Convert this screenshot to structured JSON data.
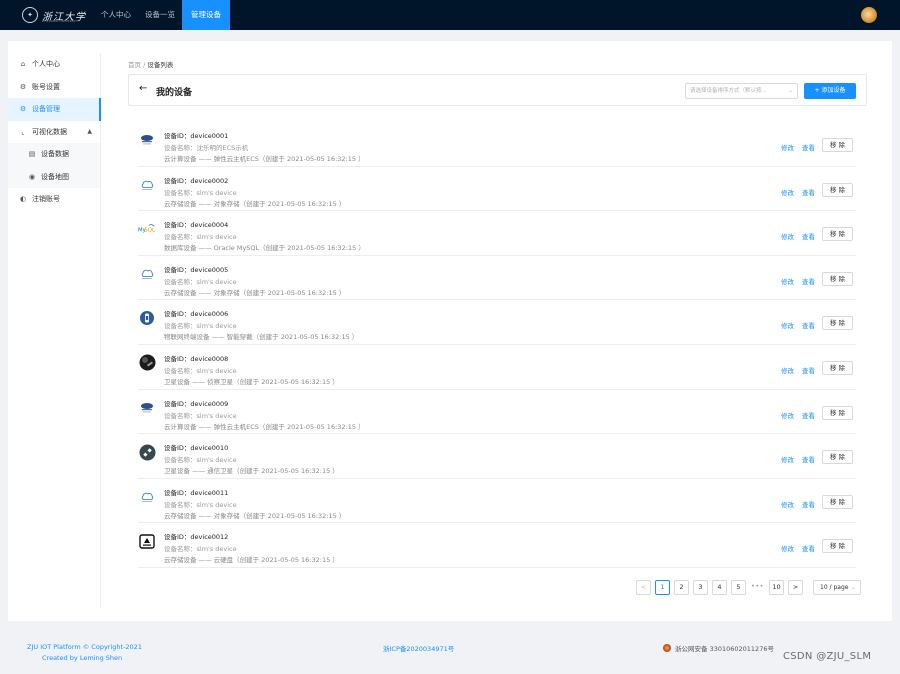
{
  "topnav": {
    "logo_text": "浙江大学",
    "logo_sub": "ZHEJIANG UNIVERSITY",
    "items": [
      {
        "label": "个人中心"
      },
      {
        "label": "设备一览"
      },
      {
        "label": "管理设备",
        "active": true
      }
    ]
  },
  "sidebar": {
    "items": [
      {
        "label": "个人中心",
        "icon": "home-icon"
      },
      {
        "label": "账号设置",
        "icon": "gear-icon"
      },
      {
        "label": "设备管理",
        "icon": "gear-icon",
        "active": true
      },
      {
        "label": "可视化数据",
        "icon": "chart-icon",
        "expanded": true
      },
      {
        "label": "设备数据",
        "icon": "table-icon",
        "sub": true
      },
      {
        "label": "设备地图",
        "icon": "map-pin-icon",
        "sub": true
      },
      {
        "label": "注销账号",
        "icon": "logout-icon"
      }
    ]
  },
  "breadcrumb": {
    "home": "首页",
    "sep": "/",
    "current": "设备列表"
  },
  "header": {
    "title": "我的设备",
    "sort_placeholder": "请选择设备排序方式（默认按...",
    "add_label": "添加设备"
  },
  "devices": [
    {
      "id": "设备ID：device0001",
      "name": "设备名称：沈乐明的ECS示机",
      "desc": "云计算设备 —— 弹性云主机ECS（创建于 2021-05-05 16:32:15 ）",
      "icon": "cloud-server-icon"
    },
    {
      "id": "设备ID：device0002",
      "name": "设备名称：slm's device",
      "desc": "云存储设备 —— 对象存储（创建于 2021-05-05 16:32:15 ）",
      "icon": "cloud-storage-icon"
    },
    {
      "id": "设备ID：device0004",
      "name": "设备名称：slm's device",
      "desc": "数据库设备 —— Oracle MySQL（创建于 2021-05-05 16:32:15 ）",
      "icon": "mysql-icon"
    },
    {
      "id": "设备ID：device0005",
      "name": "设备名称：slm's device",
      "desc": "云存储设备 —— 对象存储（创建于 2021-05-05 16:32:15 ）",
      "icon": "cloud-storage-icon"
    },
    {
      "id": "设备ID：device0006",
      "name": "设备名称：slm's device",
      "desc": "物联网终端设备 —— 智能穿戴（创建于 2021-05-05 16:32:15 ）",
      "icon": "wearable-icon"
    },
    {
      "id": "设备ID：device0008",
      "name": "设备名称：slm's device",
      "desc": "卫星设备 —— 侦察卫星（创建于 2021-05-05 16:32:15 ）",
      "icon": "satellite-photo-icon"
    },
    {
      "id": "设备ID：device0009",
      "name": "设备名称：slm's device",
      "desc": "云计算设备 —— 弹性云主机ECS（创建于 2021-05-05 16:32:15 ）",
      "icon": "cloud-server-icon"
    },
    {
      "id": "设备ID：device0010",
      "name": "设备名称：slm's device",
      "desc": "卫星设备 —— 通信卫星（创建于 2021-05-05 16:32:15 ）",
      "icon": "satellite-icon"
    },
    {
      "id": "设备ID：device0011",
      "name": "设备名称：slm's device",
      "desc": "云存储设备 —— 对象存储（创建于 2021-05-05 16:32:15 ）",
      "icon": "cloud-storage-icon"
    },
    {
      "id": "设备ID：device0012",
      "name": "设备名称：slm's device",
      "desc": "云存储设备 —— 云硬盘（创建于 2021-05-05 16:32:15 ）",
      "icon": "disk-icon"
    }
  ],
  "row_actions": {
    "edit": "修改",
    "view": "查看",
    "remove": "移 除"
  },
  "pagination": {
    "prev": "<",
    "next": ">",
    "pages": [
      "1",
      "2",
      "3",
      "4",
      "5"
    ],
    "dots": "•••",
    "last": "10",
    "current": "1",
    "page_size": "10 / page"
  },
  "footer": {
    "copyright": "ZJU IOT Platform © Copyright-2021",
    "author": "Created by Leming Shen",
    "icp": "浙ICP备2020034971号",
    "police": "浙公网安备 33010602011276号"
  },
  "watermark": "CSDN @ZJU_SLM",
  "colors": {
    "nav_bg": "#001529",
    "accent": "#1890ff",
    "page_bg": "#f0f2f5"
  }
}
